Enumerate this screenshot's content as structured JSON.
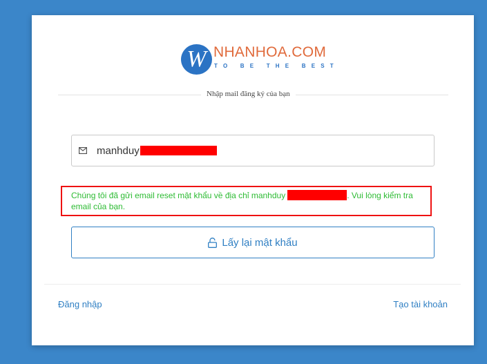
{
  "logo": {
    "letter": "W",
    "name": "NHANHOA.COM",
    "tagline": "TO BE THE BEST"
  },
  "form": {
    "section_label": "Nhập mail đăng ký của bạn",
    "email_icon": "mail-icon",
    "email_value": "manhduy",
    "message_prefix": "Chúng tôi đã gửi email reset mật khẩu về địa chỉ manhduy",
    "message_suffix": ". Vui lòng kiểm tra email của bạn.",
    "reset_button_icon": "unlock-icon",
    "reset_button_label": "Lấy lại mật khẩu"
  },
  "footer": {
    "login_link": "Đăng nhập",
    "register_link": "Tạo tài khoản"
  },
  "colors": {
    "background": "#3b86c9",
    "accent": "#2f7fc3",
    "logo_orange": "#e06a3b",
    "success_text": "#2dbb33",
    "highlight_border": "#ee1111",
    "redaction": "#ff0000"
  }
}
